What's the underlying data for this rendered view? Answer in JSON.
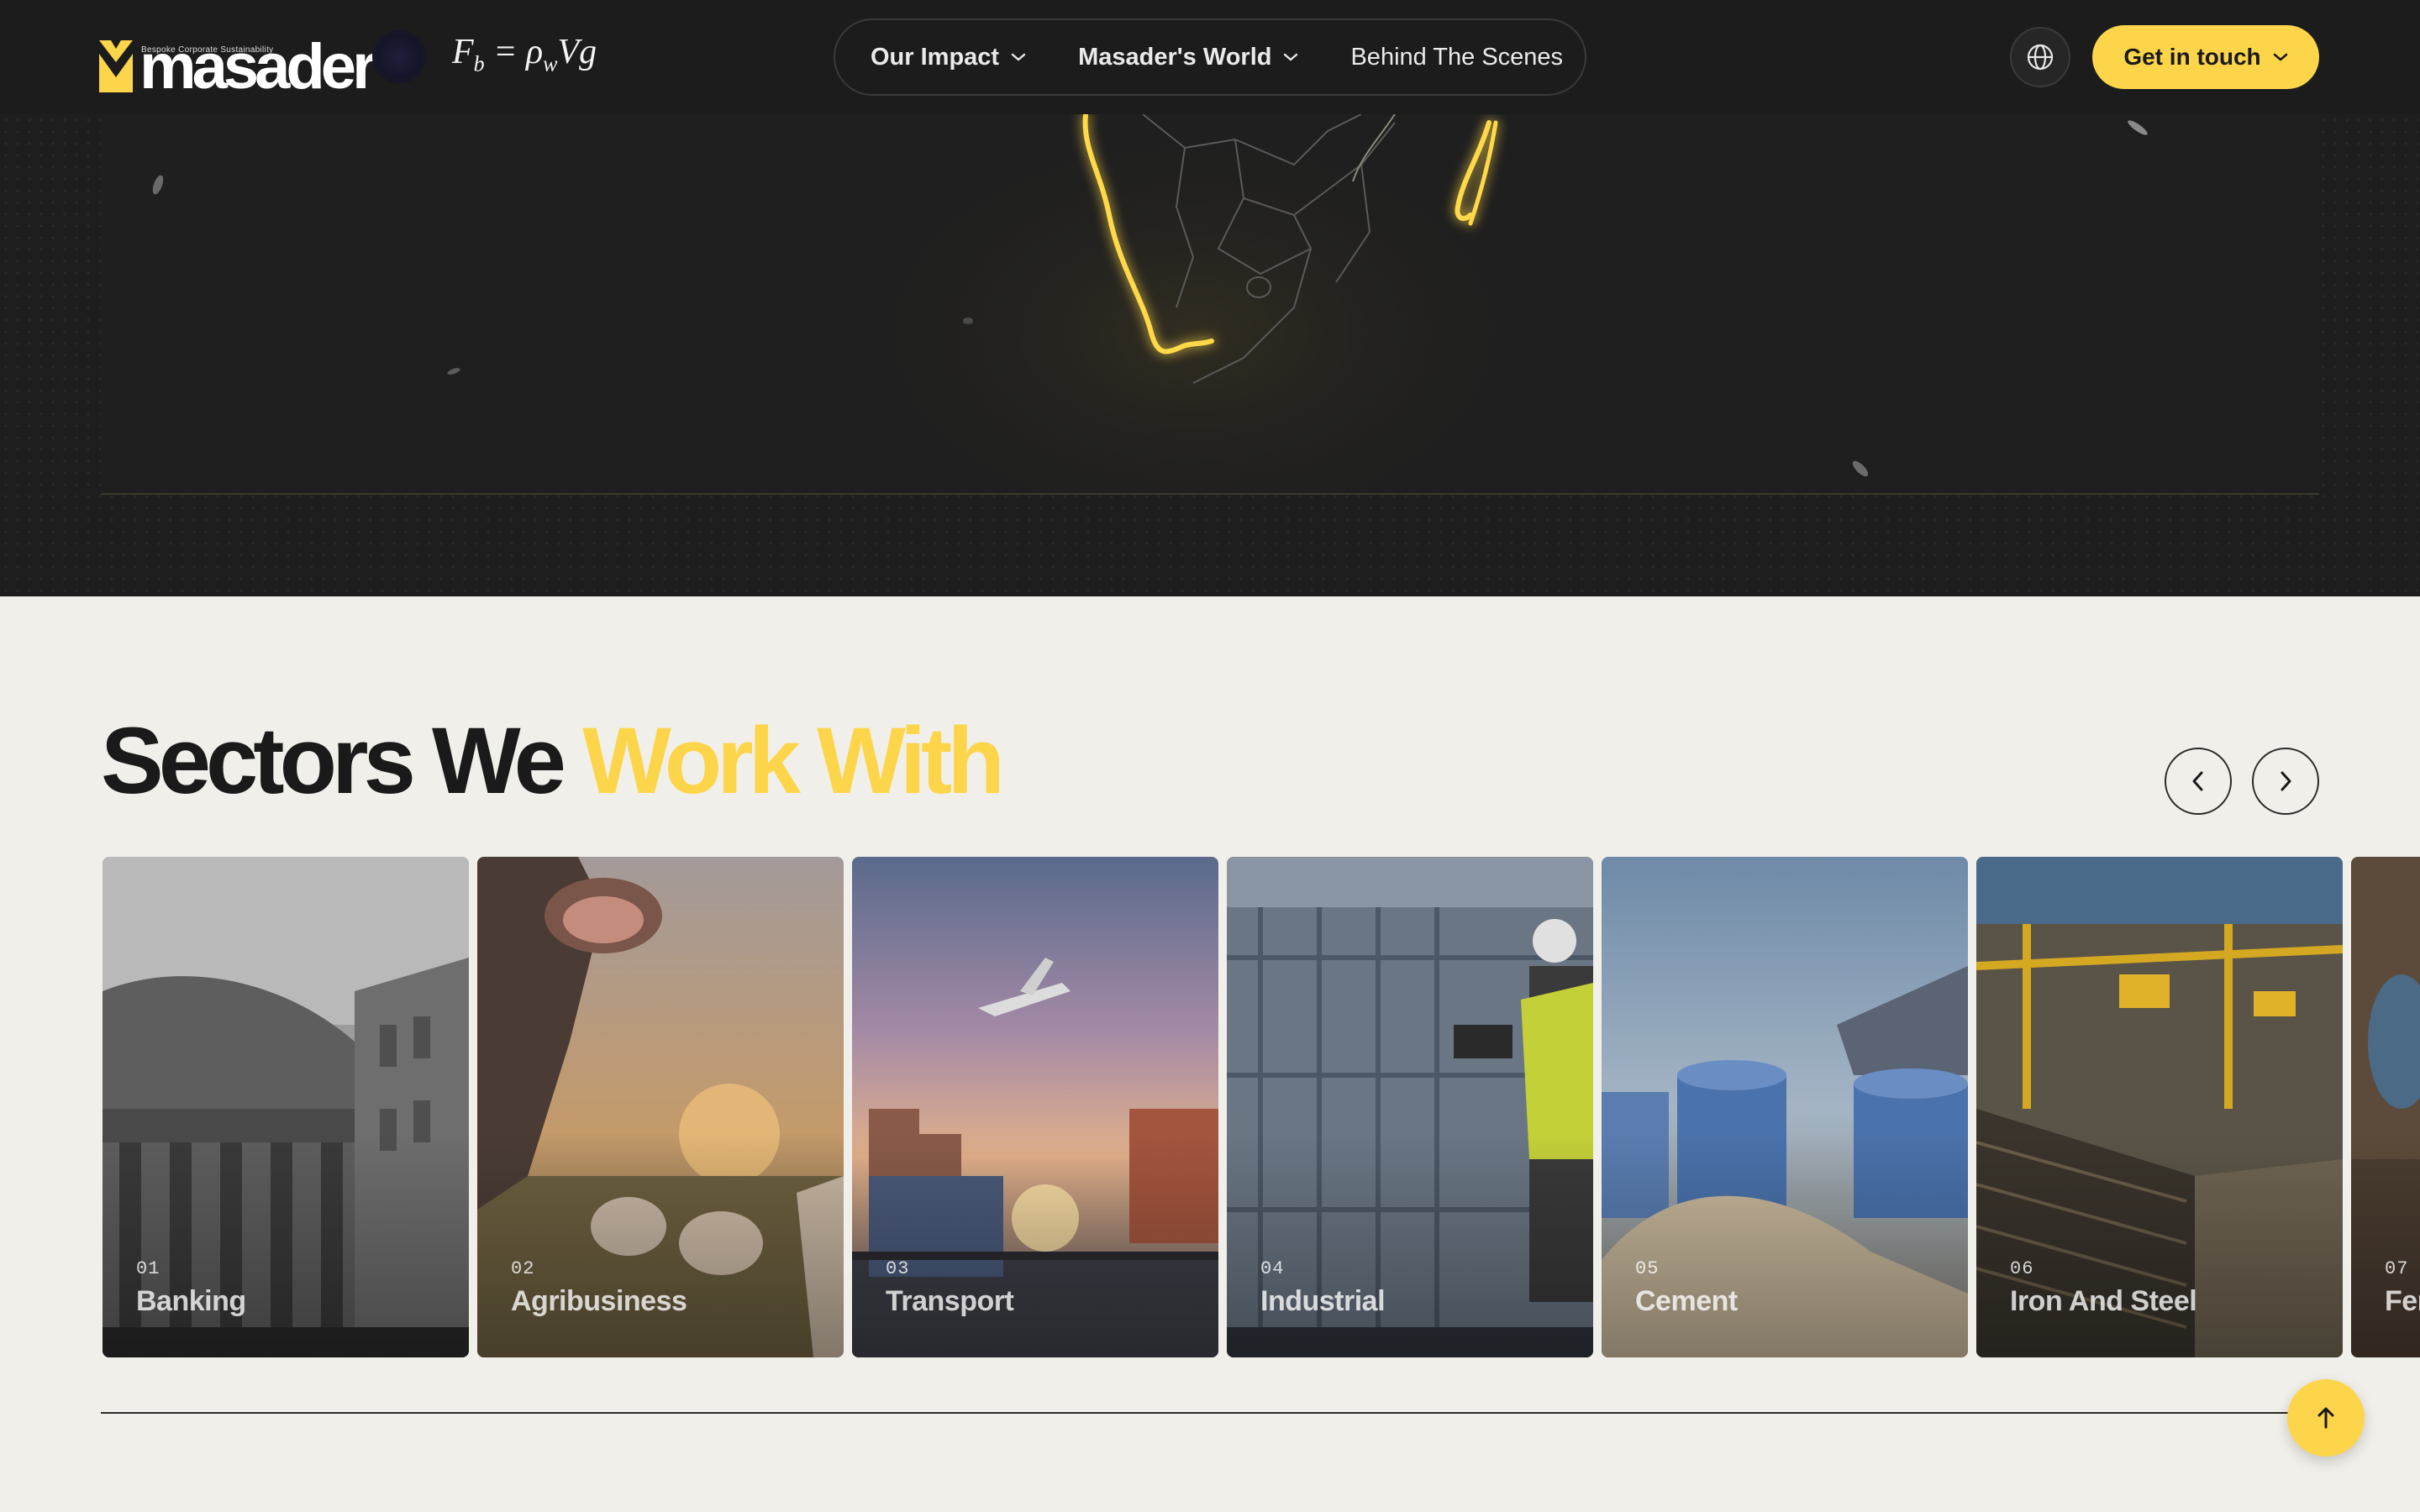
{
  "header": {
    "logo": {
      "tagline": "Bespoke Corporate Sustainability",
      "wordmark": "masader",
      "icon": "masader-logo-icon"
    },
    "formula": {
      "lhs": "F",
      "lhs_sub": "b",
      "eq": " = ρ",
      "rho_sub": "w",
      "tail": "Vg"
    },
    "nav": [
      {
        "label": "Our Impact",
        "icon": "chevron-down-icon"
      },
      {
        "label": "Masader's World",
        "icon": "chevron-down-icon"
      },
      {
        "label": "Behind The Scenes"
      }
    ],
    "language_icon": "globe-icon",
    "cta": {
      "label": "Get in touch",
      "icon": "chevron-down-icon"
    }
  },
  "sectors": {
    "title_part1": "Sectors We ",
    "title_part2": "Work With",
    "prev_icon": "chevron-left-icon",
    "next_icon": "chevron-right-icon",
    "items": [
      {
        "num": "01",
        "label": "Banking"
      },
      {
        "num": "02",
        "label": "Agribusiness"
      },
      {
        "num": "03",
        "label": "Transport"
      },
      {
        "num": "04",
        "label": "Industrial"
      },
      {
        "num": "05",
        "label": "Cement"
      },
      {
        "num": "06",
        "label": "Iron And Steel"
      },
      {
        "num": "07",
        "label": "Fer"
      }
    ]
  },
  "scroll_top_icon": "arrow-up-icon",
  "colors": {
    "accent": "#fdd54a",
    "dark": "#1c1c1c",
    "page_bg": "#f1efe9"
  }
}
